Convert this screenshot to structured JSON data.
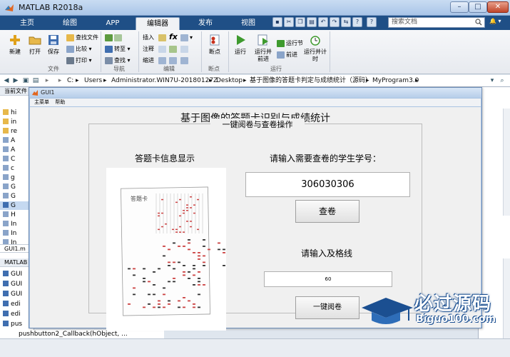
{
  "window": {
    "title": "MATLAB R2018a"
  },
  "tabs": [
    "主页",
    "绘图",
    "APP",
    "编辑器",
    "发布",
    "视图"
  ],
  "active_tab": "编辑器",
  "search": {
    "placeholder": "搜索文档"
  },
  "ribbon": {
    "file_group": {
      "label": "文件",
      "new": "新建",
      "open": "打开",
      "save": "保存",
      "find_files": "查找文件",
      "compare": "比较",
      "print": "打印"
    },
    "nav_group": {
      "label": "导航",
      "goto": "转至",
      "find": "查找"
    },
    "edit_group": {
      "label": "编辑",
      "insert": "插入",
      "comment": "注释",
      "indent": "缩进"
    },
    "breakpoints_group": {
      "label": "断点",
      "breakpoints": "断点"
    },
    "run_group": {
      "label": "运行",
      "run": "运行",
      "run_advance": "运行并前进",
      "run_section": "运行节",
      "advance": "前进",
      "run_time": "运行并计时"
    }
  },
  "address": [
    "C:",
    "Users",
    "Administrator.WIN7U-20180127Z",
    "Desktop",
    "基于图像的答题卡判定与成绩统计（源码）",
    "MyProgram3.0"
  ],
  "left_panel": {
    "header": "当前文件",
    "items": [
      "hi",
      "in",
      "re",
      "A",
      "A",
      "C",
      "c",
      "g",
      "G",
      "G",
      "G",
      "H",
      "In",
      "In",
      "In"
    ],
    "file_label": "GUI1.m",
    "workspace_header": "MATLAB",
    "functions": [
      "GUI",
      "GUI",
      "GUI",
      "edi",
      "edi",
      "pus",
      "pus"
    ],
    "bottom_line": "pushbutton2_Callback(hObject, ..."
  },
  "figure": {
    "title": "GUI1",
    "menu": [
      "主菜单",
      "帮助"
    ],
    "gui_title": "基于图像的答题卡识别与成绩统计",
    "panel_title": "一键阅卷与查卷操作",
    "sheet_label": "答题卡信息显示",
    "prompt_student": "请输入需要查卷的学生学号：",
    "student_id": "306030306",
    "check_button": "查卷",
    "prompt_grid": "请输入及格线",
    "grid_value": "60",
    "onekey_button": "一键阅卷",
    "sheet_heading": "答题卡"
  },
  "watermark": {
    "main": "必过源码",
    "sub": "Biguo100.com"
  },
  "colors": {
    "tabbar": "#1f4f86",
    "figure_frame": "#aac3e2",
    "accent": "#1b4f91"
  }
}
